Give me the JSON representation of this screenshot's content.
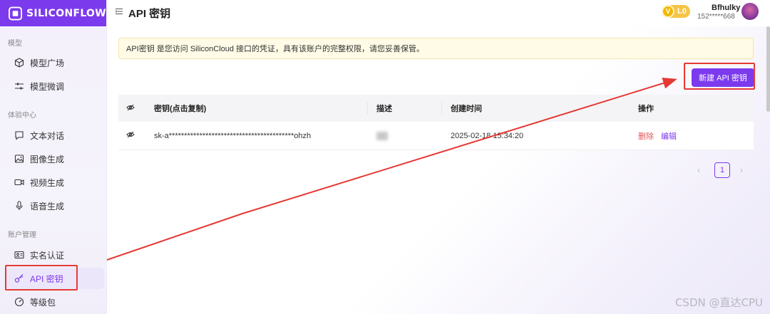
{
  "brand": {
    "logo_text": "SILICONFLOW"
  },
  "sidebar": {
    "sections": [
      {
        "label": "模型"
      },
      {
        "label": "体验中心"
      },
      {
        "label": "账户管理"
      }
    ],
    "items": [
      {
        "label": "模型广场",
        "icon": "cube-icon"
      },
      {
        "label": "模型微调",
        "icon": "sliders-icon"
      },
      {
        "label": "文本对话",
        "icon": "chat-icon"
      },
      {
        "label": "图像生成",
        "icon": "image-icon"
      },
      {
        "label": "视频生成",
        "icon": "video-icon"
      },
      {
        "label": "语音生成",
        "icon": "mic-icon"
      },
      {
        "label": "实名认证",
        "icon": "id-card-icon"
      },
      {
        "label": "API 密钥",
        "icon": "key-icon"
      },
      {
        "label": "等级包",
        "icon": "gauge-icon"
      }
    ],
    "active_item": "API 密钥"
  },
  "header": {
    "title": "API 密钥",
    "level": {
      "v": "V",
      "label": "L0"
    },
    "user": {
      "name": "Bfhulky",
      "phone": "152*****668"
    }
  },
  "main": {
    "notice": "API密钥 是您访问 SiliconCloud 接口的凭证，具有该账户的完整权限，请您妥善保管。",
    "new_key_button": "新建 API 密钥",
    "table": {
      "columns": [
        "密钥(点击复制)",
        "描述",
        "创建时间",
        "操作"
      ],
      "rows": [
        {
          "key": "sk-a*****************************************ohzh",
          "created": "2025-02-18 15:34:20",
          "actions": {
            "delete": "删除",
            "edit": "编辑"
          }
        }
      ]
    },
    "pagination": {
      "current": "1"
    }
  },
  "watermark": "CSDN @直达CPU",
  "colors": {
    "accent": "#7c3aed",
    "annotation": "#e53935",
    "delete": "#e05656"
  }
}
